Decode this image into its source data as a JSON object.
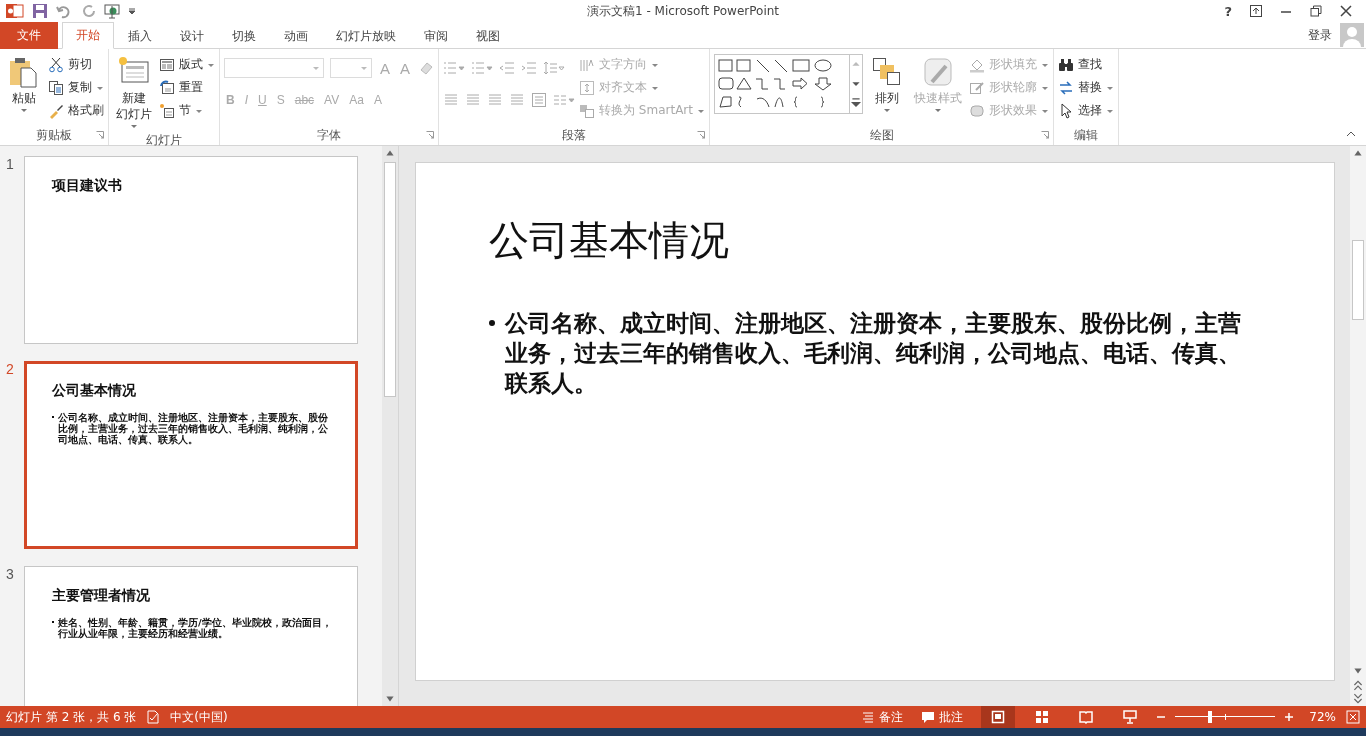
{
  "window": {
    "title": "演示文稿1 - Microsoft PowerPoint",
    "help": "?",
    "sign_in": "登录"
  },
  "tabs": [
    {
      "label": "文件",
      "kind": "file",
      "selected": false
    },
    {
      "label": "开始",
      "kind": "tab",
      "selected": true
    },
    {
      "label": "插入",
      "kind": "tab",
      "selected": false
    },
    {
      "label": "设计",
      "kind": "tab",
      "selected": false
    },
    {
      "label": "切换",
      "kind": "tab",
      "selected": false
    },
    {
      "label": "动画",
      "kind": "tab",
      "selected": false
    },
    {
      "label": "幻灯片放映",
      "kind": "tab",
      "selected": false
    },
    {
      "label": "审阅",
      "kind": "tab",
      "selected": false
    },
    {
      "label": "视图",
      "kind": "tab",
      "selected": false
    }
  ],
  "ribbon": {
    "groups": [
      {
        "kind": "clipboard",
        "label": "剪贴板",
        "large": [
          {
            "lines": [
              "粘贴"
            ],
            "disabled": false
          }
        ],
        "small": [
          {
            "label": "剪切",
            "dropdown": false,
            "disabled": false
          },
          {
            "label": "复制",
            "dropdown": true,
            "disabled": false
          },
          {
            "label": "格式刷",
            "dropdown": false,
            "disabled": false
          }
        ]
      },
      {
        "kind": "slides",
        "label": "幻灯片",
        "large": [
          {
            "lines": [
              "新建",
              "幻灯片"
            ],
            "disabled": false
          }
        ],
        "small": [
          {
            "label": "版式",
            "dropdown": true,
            "disabled": false
          },
          {
            "label": "重置",
            "dropdown": false,
            "disabled": false
          },
          {
            "label": "节",
            "dropdown": true,
            "disabled": false
          }
        ]
      },
      {
        "kind": "font",
        "label": "字体",
        "size_buttons": [
          {
            "label": "A",
            "disabled": true
          },
          {
            "label": "A",
            "disabled": true
          }
        ],
        "format_buttons": [
          {
            "label": "B",
            "disabled": true
          },
          {
            "label": "I",
            "disabled": true
          },
          {
            "label": "U",
            "disabled": true
          },
          {
            "label": "S",
            "disabled": true
          },
          {
            "label": "abc",
            "disabled": true
          },
          {
            "label": "AV",
            "disabled": true
          },
          {
            "label": "Aa",
            "disabled": true
          },
          {
            "label": "A",
            "disabled": true
          }
        ]
      },
      {
        "kind": "paragraph",
        "label": "段落",
        "small": [
          {
            "label": "文字方向",
            "dropdown": true,
            "disabled": true
          },
          {
            "label": "对齐文本",
            "dropdown": true,
            "disabled": true
          },
          {
            "label": "转换为 SmartArt",
            "dropdown": true,
            "disabled": true
          }
        ]
      },
      {
        "kind": "drawing",
        "label": "绘图",
        "large": [
          {
            "lines": [
              "排列"
            ],
            "disabled": false
          },
          {
            "lines": [
              "快速样式"
            ],
            "disabled": true
          }
        ],
        "small": [
          {
            "label": "形状填充",
            "dropdown": true,
            "disabled": true
          },
          {
            "label": "形状轮廓",
            "dropdown": true,
            "disabled": true
          },
          {
            "label": "形状效果",
            "dropdown": true,
            "disabled": true
          }
        ]
      },
      {
        "kind": "editing",
        "label": "编辑",
        "small": [
          {
            "label": "查找",
            "dropdown": false,
            "disabled": false
          },
          {
            "label": "替换",
            "dropdown": true,
            "disabled": false
          },
          {
            "label": "选择",
            "dropdown": true,
            "disabled": false
          }
        ]
      }
    ]
  },
  "thumbnails": [
    {
      "number": "1",
      "title": "项目建议书",
      "selected": false
    },
    {
      "number": "2",
      "title": "公司基本情况",
      "bullets": [
        "公司名称、成立时间、注册地区、注册资本，主要股东、股份比例，主营业务，过去三年的销售收入、毛利润、纯利润，公司地点、电话、传真、联系人。"
      ],
      "selected": true
    },
    {
      "number": "3",
      "title": "主要管理者情况",
      "bullets": [
        "姓名、性别、年龄、籍贯，学历/学位、毕业院校，政治面目，行业从业年限，主要经历和经营业绩。"
      ],
      "selected": false
    }
  ],
  "slide": {
    "title": "公司基本情况",
    "bullets": [
      "公司名称、成立时间、注册地区、注册资本，主要股东、股份比例，主营业务，过去三年的销售收入、毛利润、纯利润，公司地点、电话、传真、联系人。"
    ]
  },
  "status_bar": {
    "slide_info": "幻灯片 第 2 张，共 6 张",
    "language": "中文(中国)",
    "notes": "备注",
    "comments": "批注",
    "views": [
      {
        "selected": true
      },
      {
        "selected": false
      },
      {
        "selected": false
      },
      {
        "selected": false
      }
    ],
    "zoom": {
      "level": 0.35,
      "reading": "72%"
    }
  }
}
